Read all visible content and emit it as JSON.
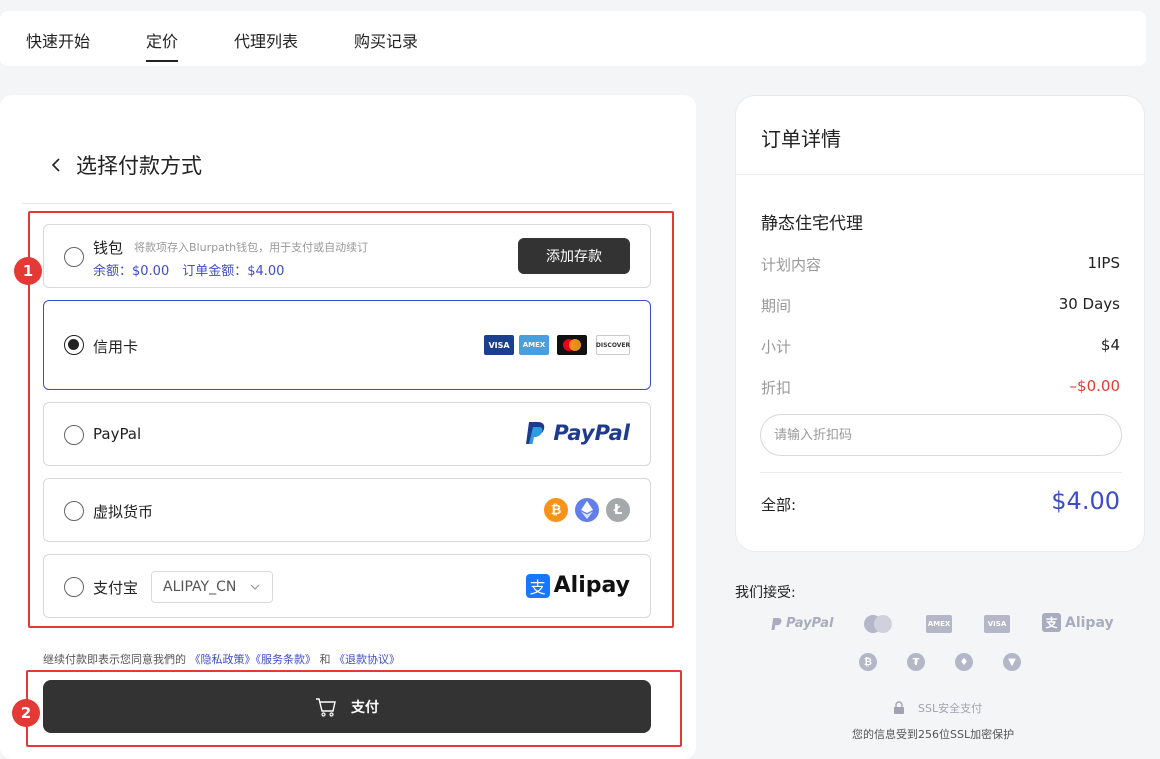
{
  "nav": {
    "tabs": [
      {
        "label": "快速开始"
      },
      {
        "label": "定价",
        "active": true
      },
      {
        "label": "代理列表"
      },
      {
        "label": "购买记录"
      }
    ]
  },
  "payment": {
    "title": "选择付款方式",
    "wallet": {
      "label": "钱包",
      "desc": "将款项存入Blurpath钱包，用于支付或自动续订",
      "balance": "余额：$0.00　订单金额：$4.00",
      "deposit_button": "添加存款"
    },
    "credit_card": {
      "label": "信用卡",
      "selected": true,
      "brands": [
        "VISA",
        "AMEX",
        "",
        "DISCOVER"
      ]
    },
    "paypal": {
      "label": "PayPal",
      "logo_text": "PayPal"
    },
    "crypto": {
      "label": "虚拟货币",
      "coins": [
        "bitcoin-icon",
        "ethereum-icon",
        "litecoin-icon"
      ]
    },
    "alipay": {
      "label": "支付宝",
      "select_value": "ALIPAY_CN",
      "logo_text": "Alipay"
    },
    "terms": {
      "prefix": "继续付款即表示您同意我們的",
      "privacy": "《隐私政策》",
      "service": "《服务条款》",
      "and": "和",
      "refund": "《退款协议》"
    },
    "pay_button": "支付"
  },
  "annotations": {
    "badge1": "1",
    "badge2": "2",
    "color": "#e53935"
  },
  "order": {
    "title": "订单详情",
    "product": "静态住宅代理",
    "rows": [
      {
        "label": "计划内容",
        "value": "1IPS"
      },
      {
        "label": "期间",
        "value": "30 Days"
      },
      {
        "label": "小计",
        "value": "$4"
      },
      {
        "label": "折扣",
        "value": "–$0.00"
      }
    ],
    "coupon_placeholder": "请输入折扣码",
    "total_label": "全部:",
    "total_value": "$4.00"
  },
  "accepts": {
    "title": "我们接受:",
    "paypal": "PayPal",
    "amex": "AMEX",
    "visa": "VISA",
    "alipay": "Alipay",
    "ssl_label": "SSL安全支付",
    "ssl_note": "您的信息受到256位SSL加密保护"
  },
  "colors": {
    "accent": "#3d4cc8",
    "dark_button": "#333333",
    "discount": "#e53935"
  }
}
